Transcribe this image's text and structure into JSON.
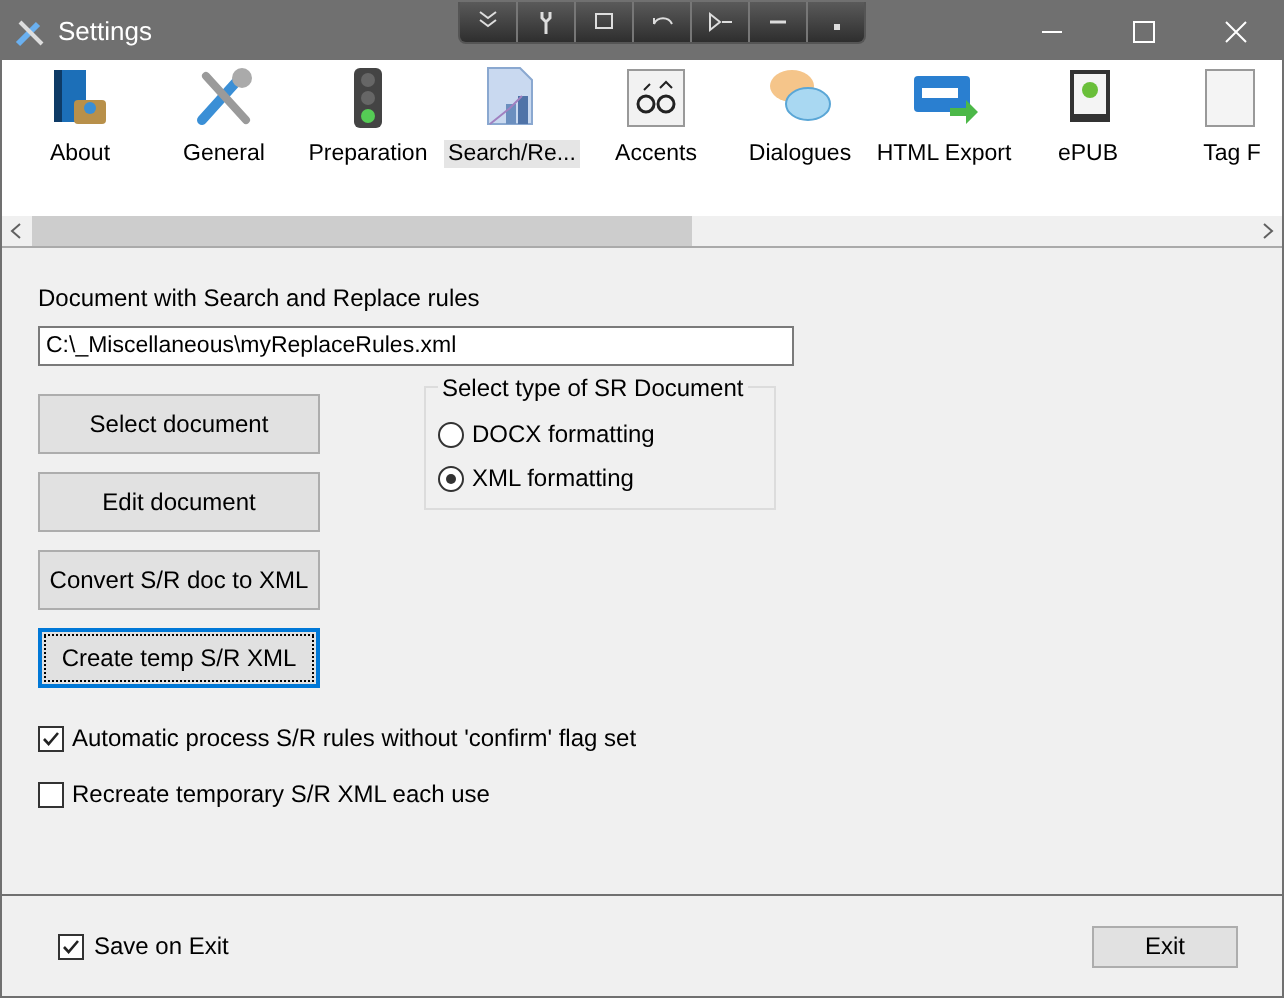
{
  "window": {
    "title": "Settings"
  },
  "tabs": [
    {
      "label": "About",
      "selected": false
    },
    {
      "label": "General",
      "selected": false
    },
    {
      "label": "Preparation",
      "selected": false
    },
    {
      "label": "Search/Re...",
      "selected": true
    },
    {
      "label": "Accents",
      "selected": false
    },
    {
      "label": "Dialogues",
      "selected": false
    },
    {
      "label": "HTML Export",
      "selected": false
    },
    {
      "label": "ePUB",
      "selected": false
    },
    {
      "label": "Tag F",
      "selected": false
    }
  ],
  "document": {
    "label": "Document with Search and Replace rules",
    "value": "C:\\_Miscellaneous\\myReplaceRules.xml"
  },
  "buttons": [
    {
      "label": "Select document",
      "focused": false
    },
    {
      "label": "Edit document",
      "focused": false
    },
    {
      "label": "Convert S/R doc to XML",
      "focused": false
    },
    {
      "label": "Create temp S/R XML",
      "focused": true
    }
  ],
  "sr_type": {
    "title": "Select type of SR Document",
    "options": [
      {
        "label": "DOCX formatting",
        "selected": false
      },
      {
        "label": "XML formatting",
        "selected": true
      }
    ]
  },
  "checkboxes": [
    {
      "label": "Automatic process S/R rules without 'confirm' flag set",
      "checked": true
    },
    {
      "label": "Recreate temporary S/R XML each use",
      "checked": false
    }
  ],
  "footer": {
    "save_on_exit": {
      "label": "Save on Exit",
      "checked": true
    },
    "exit_button": "Exit"
  }
}
